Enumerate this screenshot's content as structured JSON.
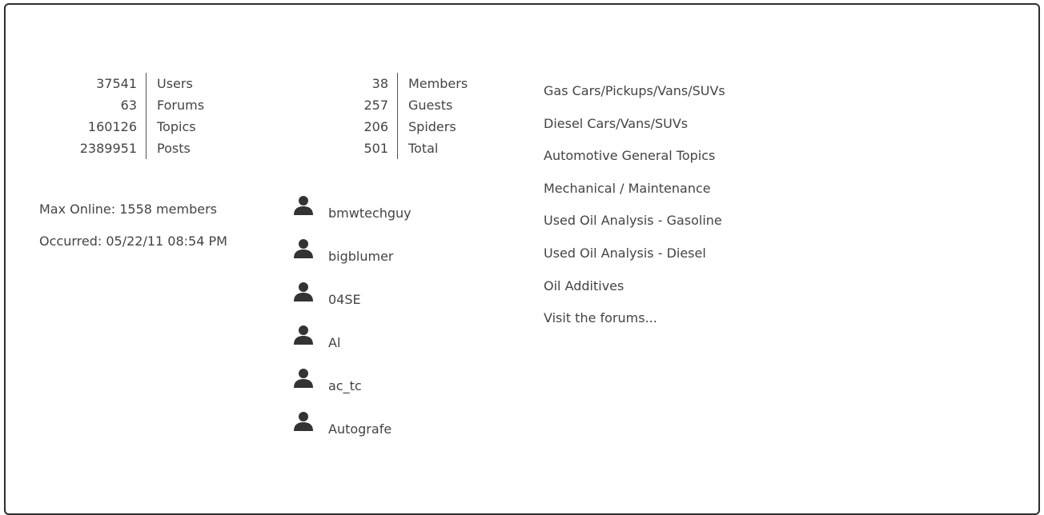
{
  "forum_stats": [
    {
      "count": "37541",
      "label": "Users"
    },
    {
      "count": "63",
      "label": "Forums"
    },
    {
      "count": "160126",
      "label": "Topics"
    },
    {
      "count": "2389951",
      "label": "Posts"
    }
  ],
  "online_stats": [
    {
      "count": "38",
      "label": "Members"
    },
    {
      "count": "257",
      "label": "Guests"
    },
    {
      "count": "206",
      "label": "Spiders"
    },
    {
      "count": "501",
      "label": "Total"
    }
  ],
  "record": {
    "max_online": "Max Online: 1558 members",
    "occurred": "Occurred: 05/22/11 08:54 PM"
  },
  "online_users": [
    {
      "name": "bmwtechguy",
      "icon": "user-silhouette-icon"
    },
    {
      "name": "bigblumer",
      "icon": "user-silhouette-icon"
    },
    {
      "name": "04SE",
      "icon": "user-silhouette-icon"
    },
    {
      "name": "Al",
      "icon": "user-silhouette-icon"
    },
    {
      "name": "ac_tc",
      "icon": "user-silhouette-icon"
    },
    {
      "name": "Autografe",
      "icon": "user-silhouette-icon"
    }
  ],
  "forum_links": [
    "Gas Cars/Pickups/Vans/SUVs",
    "Diesel Cars/Vans/SUVs",
    "Automotive General Topics",
    "Mechanical / Maintenance",
    "Used Oil Analysis - Gasoline",
    "Used Oil Analysis - Diesel",
    "Oil Additives",
    "Visit the forums..."
  ],
  "colors": {
    "text": "#444444",
    "border": "#2e2e2e",
    "divider": "#555555",
    "icon": "#333333"
  }
}
